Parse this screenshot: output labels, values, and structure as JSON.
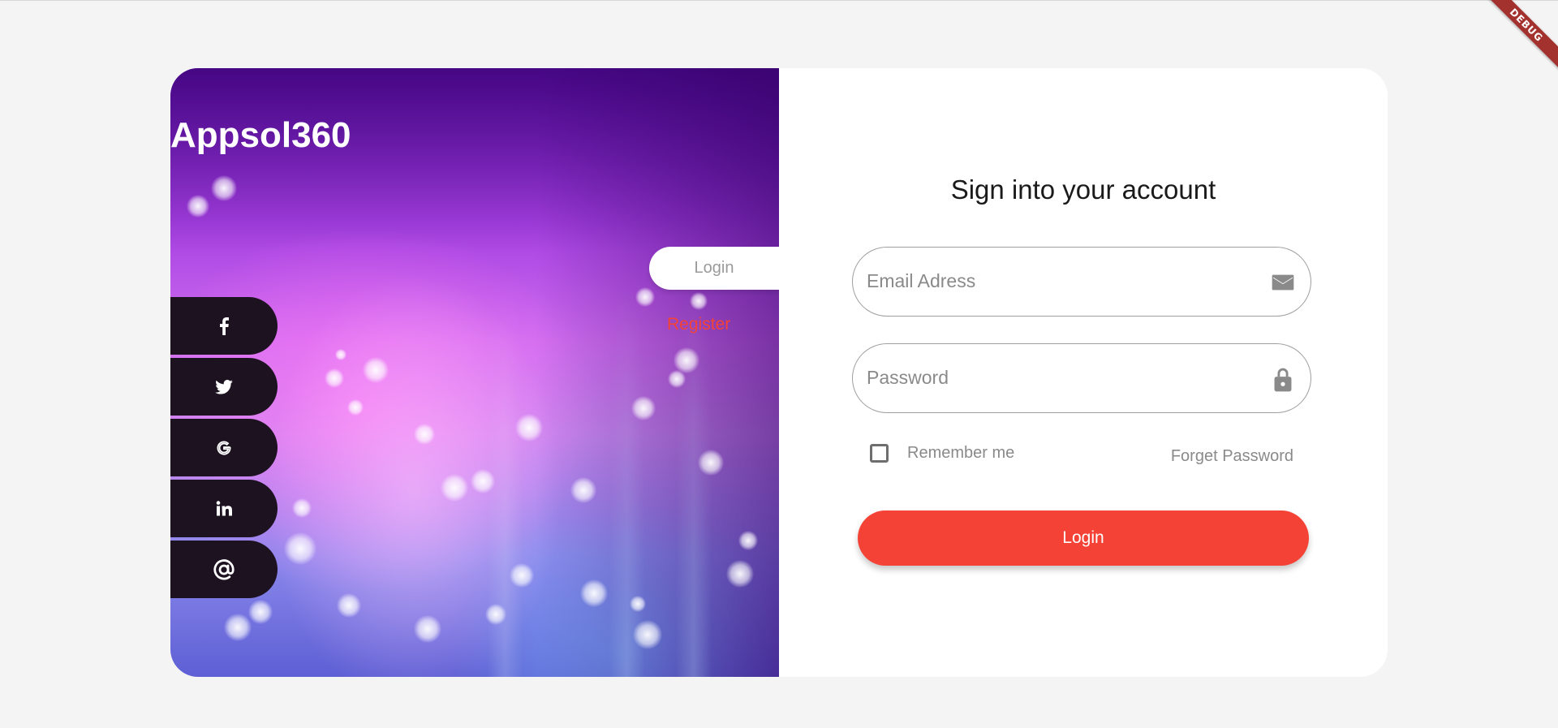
{
  "brand": {
    "name": "Appsol360"
  },
  "auth_tabs": {
    "login_label": "Login",
    "register_label": "Register"
  },
  "social": {
    "items": [
      {
        "icon": "facebook-icon"
      },
      {
        "icon": "twitter-icon"
      },
      {
        "icon": "google-icon"
      },
      {
        "icon": "linkedin-icon"
      },
      {
        "icon": "at-sign-icon"
      }
    ]
  },
  "form": {
    "title": "Sign into your account",
    "email_placeholder": "Email Adress",
    "email_value": "",
    "email_icon": "mail-icon",
    "password_placeholder": "Password",
    "password_value": "",
    "password_icon": "lock-icon",
    "remember_label": "Remember me",
    "remember_checked": false,
    "forgot_label": "Forget Password",
    "submit_label": "Login"
  },
  "debug_banner": {
    "label": "DEBUG"
  },
  "colors": {
    "accent": "#f44336",
    "social_button_bg": "#1d1220",
    "page_bg": "#f4f4f4",
    "debug_banner_bg": "#a3312d"
  }
}
